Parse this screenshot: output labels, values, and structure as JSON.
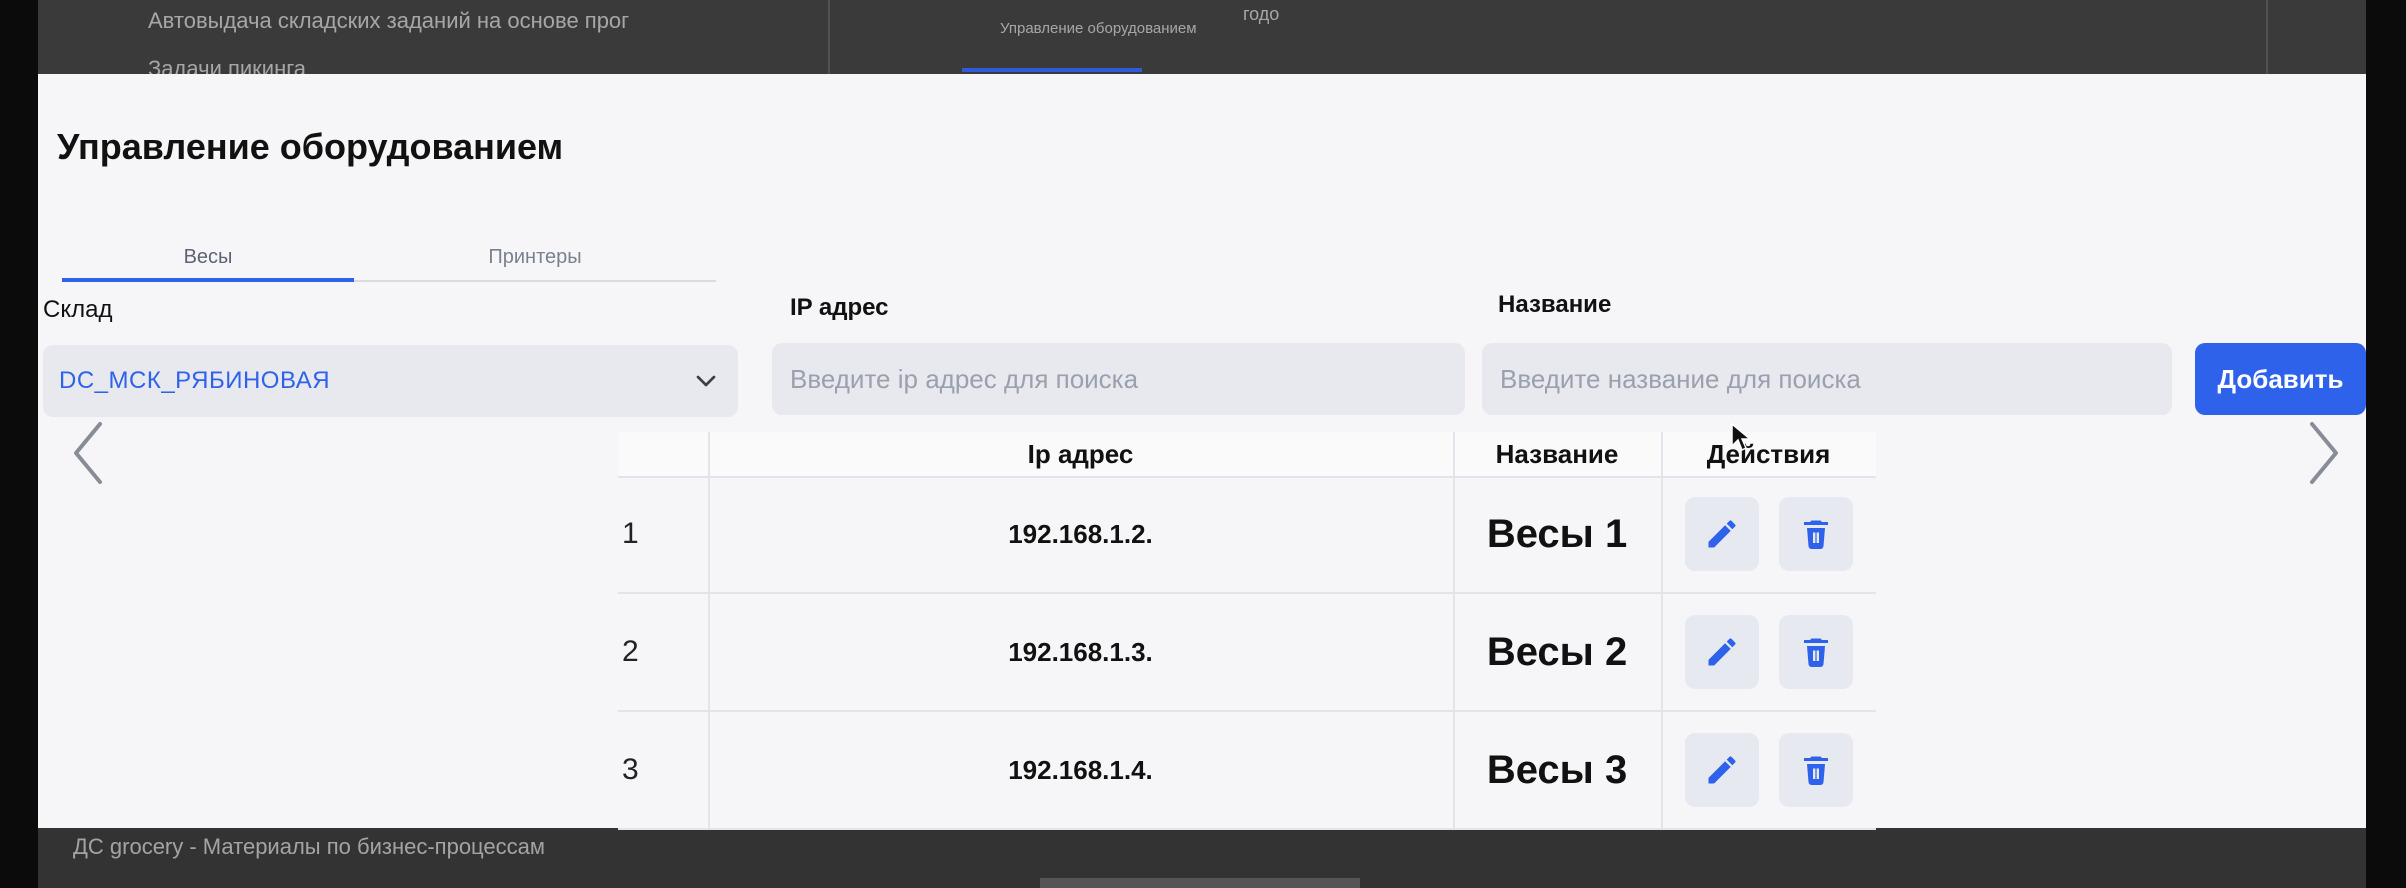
{
  "modal": {
    "title": "Управление оборудованием",
    "tabs": [
      {
        "label": "Весы",
        "active": true
      },
      {
        "label": "Принтеры",
        "active": false
      }
    ],
    "filters": {
      "warehouse_label": "Склад",
      "warehouse_value": "DC_МСК_РЯБИНОВАЯ",
      "ip_label": "IP адрес",
      "ip_placeholder": "Введите ip адрес для поиска",
      "name_label": "Название",
      "name_placeholder": "Введите название для поиска"
    },
    "add_button_label": "Добавить",
    "table": {
      "headers": [
        "",
        "Ip адрес",
        "Название",
        "Действия"
      ],
      "rows": [
        {
          "num": "1",
          "ip": "192.168.1.2.",
          "name": "Весы 1"
        },
        {
          "num": "2",
          "ip": "192.168.1.3.",
          "name": "Весы 2"
        },
        {
          "num": "3",
          "ip": "192.168.1.4.",
          "name": "Весы 3"
        }
      ]
    },
    "icons": {
      "edit": "pencil-icon",
      "delete": "trash-icon",
      "prev": "chevron-left-icon",
      "next": "chevron-right-icon",
      "dropdown": "chevron-down-icon"
    }
  },
  "background": {
    "top_line_1": "Автовыдача складских заданий на основе прог",
    "top_line_2": "Задачи пикинга",
    "top_tab": "Управление оборудованием",
    "top_small": "годо",
    "bottom_line": "ДС grocery - Материалы по бизнес-процессам"
  },
  "colors": {
    "accent": "#2f62ea",
    "field_bg": "#e8e9ee",
    "modal_bg": "#f6f6f8"
  }
}
